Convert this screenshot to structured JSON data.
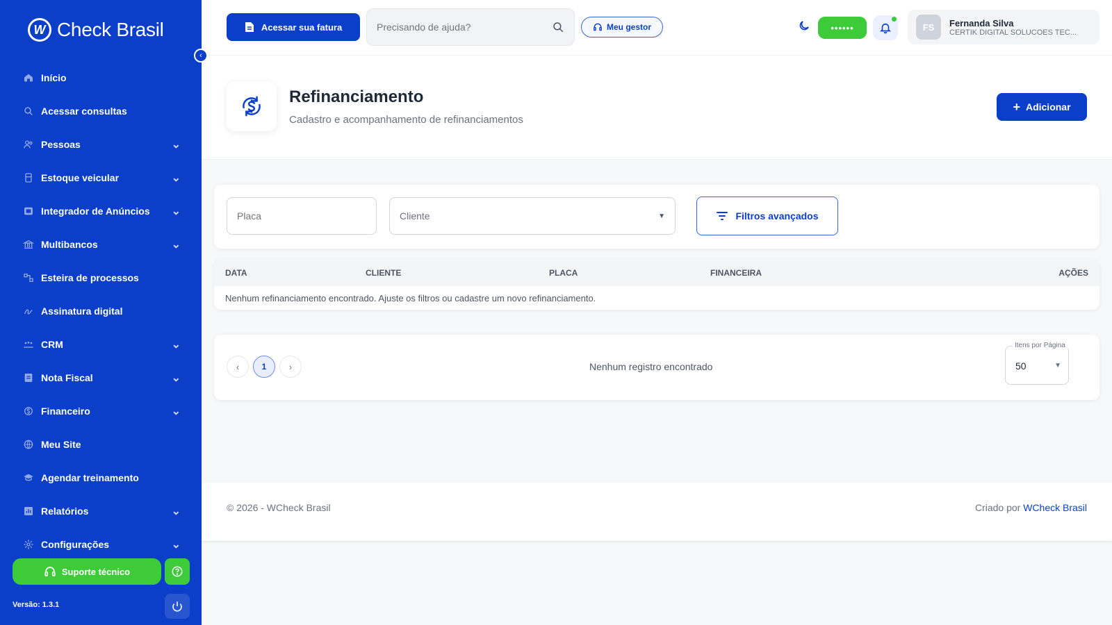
{
  "brand": {
    "name": "Check Brasil",
    "mark": "W"
  },
  "sidebar": {
    "items": [
      {
        "label": "Início",
        "icon": "home-icon",
        "chevron": false
      },
      {
        "label": "Acessar consultas",
        "icon": "search-icon",
        "chevron": false
      },
      {
        "label": "Pessoas",
        "icon": "people-icon",
        "chevron": true
      },
      {
        "label": "Estoque veicular",
        "icon": "car-icon",
        "chevron": true
      },
      {
        "label": "Integrador de Anúncios",
        "icon": "ads-icon",
        "chevron": true
      },
      {
        "label": "Multibancos",
        "icon": "bank-icon",
        "chevron": true
      },
      {
        "label": "Esteira de processos",
        "icon": "flow-icon",
        "chevron": false
      },
      {
        "label": "Assinatura digital",
        "icon": "signature-icon",
        "chevron": false
      },
      {
        "label": "CRM",
        "icon": "crm-icon",
        "chevron": true
      },
      {
        "label": "Nota Fiscal",
        "icon": "invoice-icon",
        "chevron": true
      },
      {
        "label": "Financeiro",
        "icon": "finance-icon",
        "chevron": true
      },
      {
        "label": "Meu Site",
        "icon": "globe-icon",
        "chevron": false
      },
      {
        "label": "Agendar treinamento",
        "icon": "graduation-icon",
        "chevron": false
      },
      {
        "label": "Relatórios",
        "icon": "report-icon",
        "chevron": true
      },
      {
        "label": "Configurações",
        "icon": "gear-icon",
        "chevron": true
      }
    ],
    "support_label": "Suporte técnico",
    "version": "Versão: 1.3.1"
  },
  "topbar": {
    "invoice_label": "Acessar sua fatura",
    "help_placeholder": "Precisando de ajuda?",
    "manager_label": "Meu gestor",
    "status_text": "••••••",
    "user": {
      "initials": "FS",
      "name": "Fernanda Silva",
      "company": "CERTIK DIGITAL SOLUCOES TEC..."
    }
  },
  "page": {
    "title": "Refinanciamento",
    "subtitle": "Cadastro e acompanhamento de refinanciamentos",
    "add_label": "Adicionar"
  },
  "filters": {
    "plate_placeholder": "Placa",
    "client_placeholder": "Cliente",
    "advanced_label": "Filtros avançados"
  },
  "table": {
    "columns": [
      "DATA",
      "CLIENTE",
      "PLACA",
      "FINANCEIRA",
      "AÇÕES"
    ],
    "empty_message": "Nenhum refinanciamento encontrado. Ajuste os filtros ou cadastre um novo refinanciamento."
  },
  "pagination": {
    "current_page": "1",
    "info": "Nenhum registro encontrado",
    "per_page_label": "Itens por Página",
    "per_page_value": "50"
  },
  "footer": {
    "copyright": "© 2026 - WCheck Brasil",
    "created_by": "Criado por",
    "created_by_link": "WCheck Brasil"
  },
  "colors": {
    "primary": "#0b3fc9",
    "success": "#3dcb3a"
  }
}
